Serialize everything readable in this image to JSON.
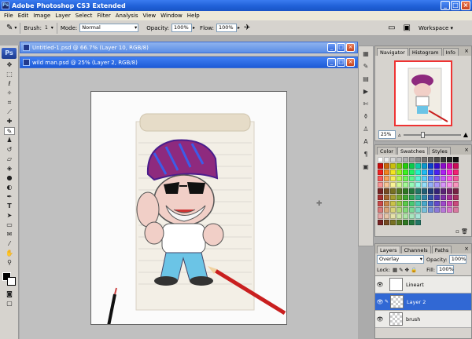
{
  "window": {
    "title": "Adobe Photoshop CS3 Extended"
  },
  "menu": [
    "File",
    "Edit",
    "Image",
    "Layer",
    "Select",
    "Filter",
    "Analysis",
    "View",
    "Window",
    "Help"
  ],
  "options": {
    "brush_label": "Brush:",
    "brush_size": "1",
    "mode_label": "Mode:",
    "mode_value": "Normal",
    "opacity_label": "Opacity:",
    "opacity_value": "100%",
    "flow_label": "Flow:",
    "flow_value": "100%",
    "workspace_label": "Workspace"
  },
  "documents": [
    {
      "title": "Untitled-1.psd @ 66.7% (Layer 10, RGB/8)"
    },
    {
      "title": "wild man.psd @ 25% (Layer 2, RGB/8)"
    }
  ],
  "navigator": {
    "tabs": [
      "Navigator",
      "Histogram",
      "Info"
    ],
    "zoom": "25%"
  },
  "color_panel": {
    "tabs": [
      "Color",
      "Swatches",
      "Styles"
    ]
  },
  "layers_panel": {
    "tabs": [
      "Layers",
      "Channels",
      "Paths"
    ],
    "blend_mode": "Overlay",
    "opacity_label": "Opacity:",
    "opacity_value": "100%",
    "lock_label": "Lock:",
    "fill_label": "Fill:",
    "fill_value": "100%",
    "layers": [
      {
        "name": "Lineart",
        "selected": false
      },
      {
        "name": "Layer 2",
        "selected": true
      },
      {
        "name": "brush",
        "selected": false
      }
    ]
  },
  "colors": {
    "titlebar": "#1f5fd6",
    "selection": "#3168d4",
    "workspace": "#ababab"
  }
}
